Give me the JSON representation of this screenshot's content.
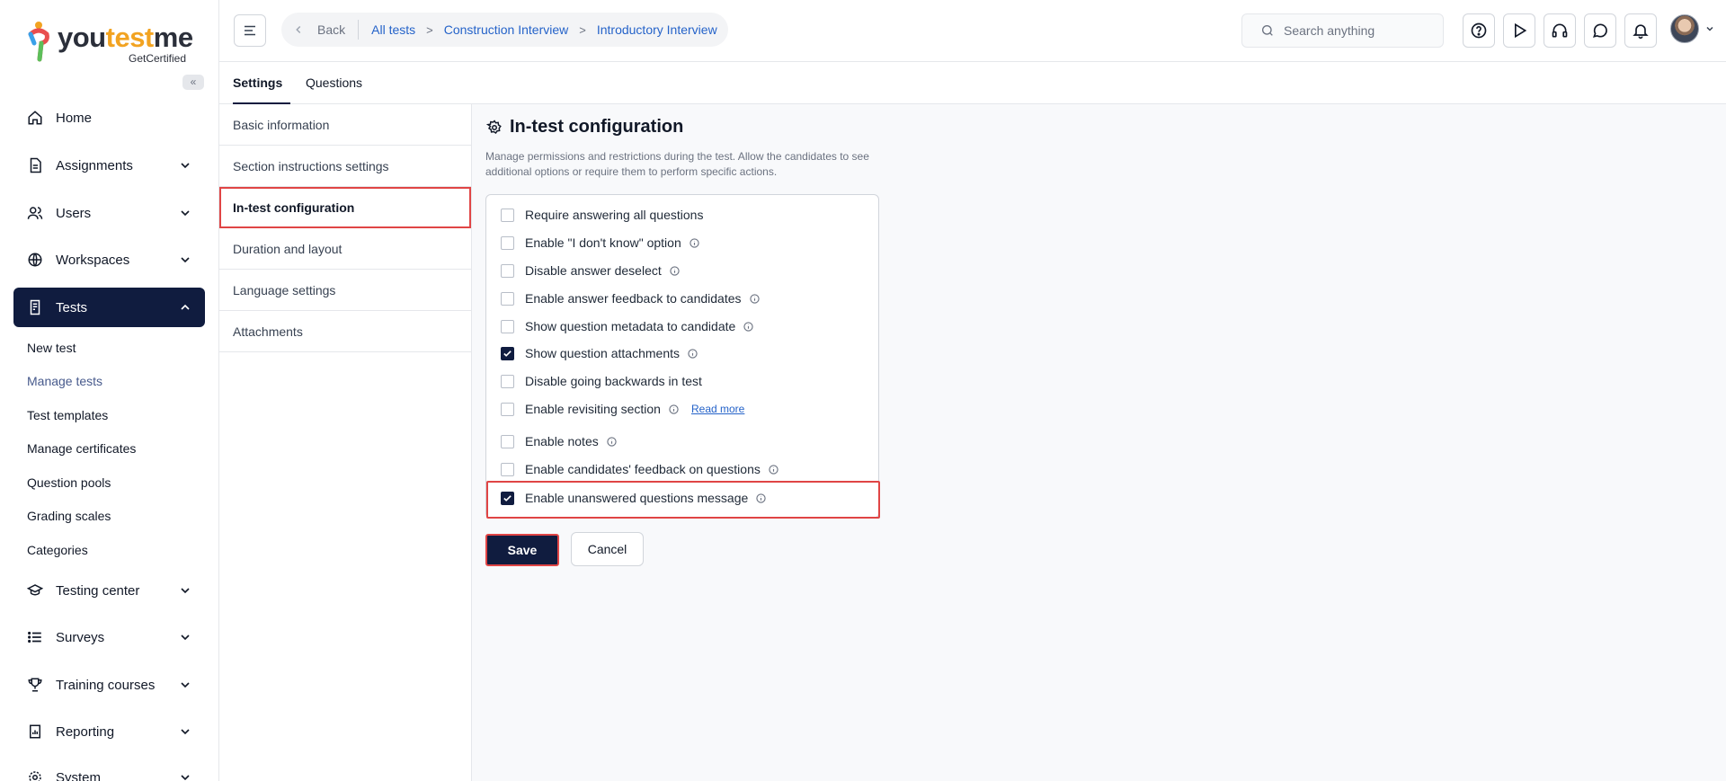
{
  "logo": {
    "word_a": "you",
    "word_b": "test",
    "word_c": "me",
    "tagline": "GetCertified"
  },
  "sidebar": {
    "collapse_label": "«",
    "items": [
      {
        "label": "Home",
        "icon": "home-icon"
      },
      {
        "label": "Assignments",
        "icon": "document-icon"
      },
      {
        "label": "Users",
        "icon": "users-icon"
      },
      {
        "label": "Workspaces",
        "icon": "globe-icon"
      },
      {
        "label": "Tests",
        "icon": "test-icon"
      },
      {
        "label": "Testing center",
        "icon": "graduation-cap-icon"
      },
      {
        "label": "Surveys",
        "icon": "list-icon"
      },
      {
        "label": "Training courses",
        "icon": "trophy-icon"
      },
      {
        "label": "Reporting",
        "icon": "report-icon"
      },
      {
        "label": "System",
        "icon": "gear-icon"
      }
    ],
    "tests_sub": [
      "New test",
      "Manage tests",
      "Test templates",
      "Manage certificates",
      "Question pools",
      "Grading scales",
      "Categories"
    ]
  },
  "topbar": {
    "back": "Back",
    "crumbs": [
      "All tests",
      "Construction Interview",
      "Introductory Interview"
    ],
    "search_placeholder": "Search anything"
  },
  "tabs": [
    "Settings",
    "Questions"
  ],
  "settings_menu": [
    "Basic information",
    "Section instructions settings",
    "In-test configuration",
    "Duration and layout",
    "Language settings",
    "Attachments"
  ],
  "main": {
    "title": "In-test configuration",
    "description": "Manage permissions and restrictions during the test. Allow the candidates to see additional options or require them to perform specific actions.",
    "options": [
      {
        "label": "Require answering all questions",
        "checked": false,
        "info": false
      },
      {
        "label": "Enable \"I don't know\" option",
        "checked": false,
        "info": true
      },
      {
        "label": "Disable answer deselect",
        "checked": false,
        "info": true
      },
      {
        "label": "Enable answer feedback to candidates",
        "checked": false,
        "info": true
      },
      {
        "label": "Show question metadata to candidate",
        "checked": false,
        "info": true
      },
      {
        "label": "Show question attachments",
        "checked": true,
        "info": true
      },
      {
        "label": "Disable going backwards in test",
        "checked": false,
        "info": false
      },
      {
        "label": "Enable revisiting section",
        "checked": false,
        "info": true
      },
      {
        "label": "Enable notes",
        "checked": false,
        "info": true
      },
      {
        "label": "Enable candidates' feedback on questions",
        "checked": false,
        "info": true
      },
      {
        "label": "Enable unanswered questions message",
        "checked": true,
        "info": true
      }
    ],
    "read_more": "Read more",
    "save": "Save",
    "cancel": "Cancel"
  },
  "colors": {
    "primary": "#101c3f",
    "link": "#2563c9",
    "highlight": "#e04545",
    "accent": "#f2a321"
  }
}
